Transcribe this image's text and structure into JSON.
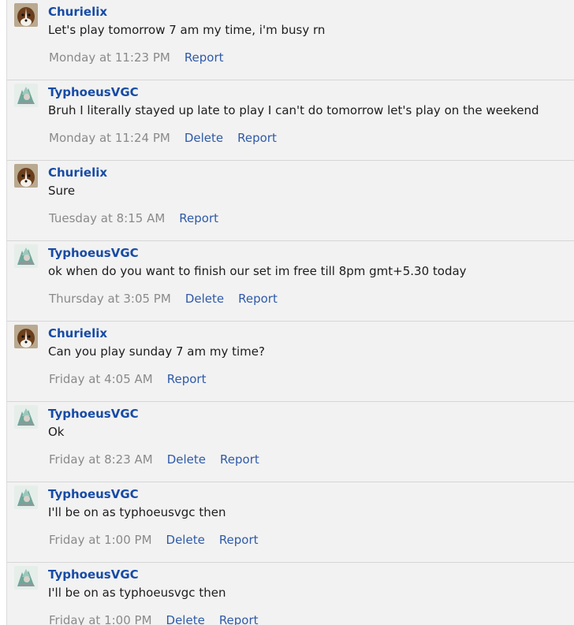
{
  "messages": [
    {
      "author": "Churielix",
      "avatar": "dog-avatar",
      "text": "Let's play tomorrow 7 am my time, i'm busy rn",
      "time": "Monday at 11:23 PM",
      "actions": [
        "Report"
      ]
    },
    {
      "author": "TyphoeusVGC",
      "avatar": "pokemon-avatar",
      "text": "Bruh I literally stayed up late to play I can't do tomorrow let's play on the weekend",
      "time": "Monday at 11:24 PM",
      "actions": [
        "Delete",
        "Report"
      ]
    },
    {
      "author": "Churielix",
      "avatar": "dog-avatar",
      "text": "Sure",
      "time": "Tuesday at 8:15 AM",
      "actions": [
        "Report"
      ]
    },
    {
      "author": "TyphoeusVGC",
      "avatar": "pokemon-avatar",
      "text": "ok when do you want to finish our set im free till 8pm gmt+5.30 today",
      "time": "Thursday at 3:05 PM",
      "actions": [
        "Delete",
        "Report"
      ]
    },
    {
      "author": "Churielix",
      "avatar": "dog-avatar",
      "text": "Can you play sunday 7 am my time?",
      "time": "Friday at 4:05 AM",
      "actions": [
        "Report"
      ]
    },
    {
      "author": "TyphoeusVGC",
      "avatar": "pokemon-avatar",
      "text": "Ok",
      "time": "Friday at 8:23 AM",
      "actions": [
        "Delete",
        "Report"
      ]
    },
    {
      "author": "TyphoeusVGC",
      "avatar": "pokemon-avatar",
      "text": "I'll be on as typhoeusvgc then",
      "time": "Friday at 1:00 PM",
      "actions": [
        "Delete",
        "Report"
      ]
    },
    {
      "author": "TyphoeusVGC",
      "avatar": "pokemon-avatar",
      "text": "I'll be on as typhoeusvgc then",
      "time": "Friday at 1:00 PM",
      "actions": [
        "Delete",
        "Report"
      ]
    }
  ]
}
